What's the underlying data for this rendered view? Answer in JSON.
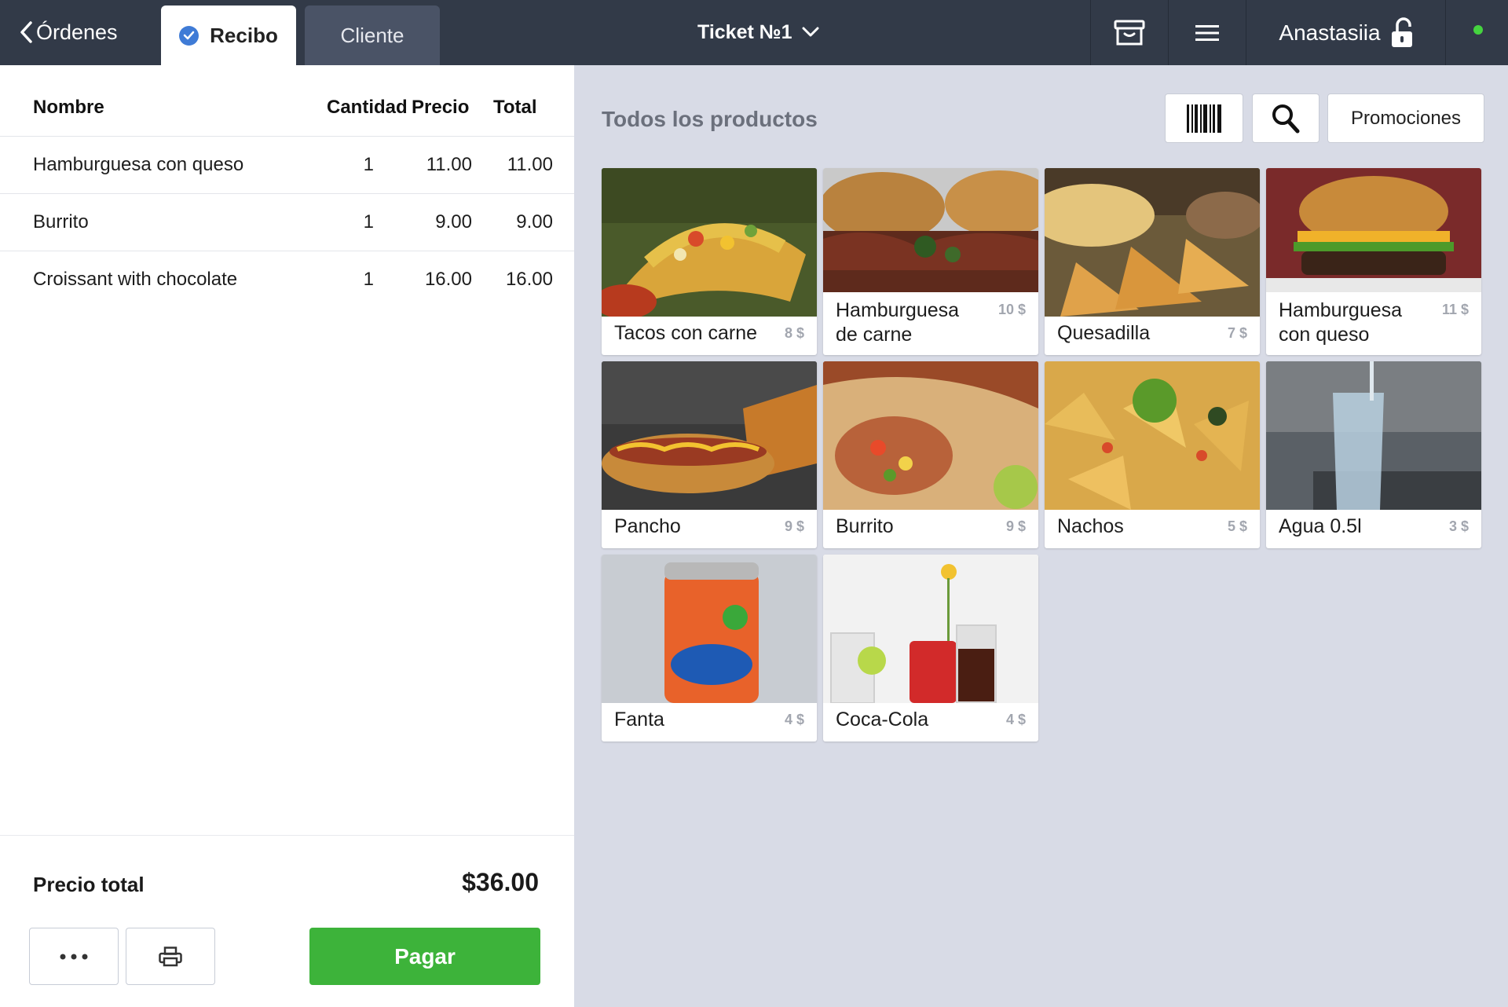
{
  "header": {
    "back_label": "Órdenes",
    "tabs": [
      {
        "label": "Recibo",
        "active": true
      },
      {
        "label": "Cliente",
        "active": false
      }
    ],
    "ticket_label": "Ticket №1",
    "user_name": "Anastasiia",
    "status_color": "#45d43f"
  },
  "receipt": {
    "columns": [
      "Nombre",
      "Cantidad",
      "Precio",
      "Total"
    ],
    "rows": [
      {
        "name": "Hamburguesa con queso",
        "qty": "1",
        "price": "11.00",
        "total": "11.00"
      },
      {
        "name": "Burrito",
        "qty": "1",
        "price": "9.00",
        "total": "9.00"
      },
      {
        "name": "Croissant with chocolate",
        "qty": "1",
        "price": "16.00",
        "total": "16.00"
      }
    ],
    "total_label": "Precio total",
    "total_value": "$36.00",
    "pay_label": "Pagar",
    "pay_color": "#3db33a"
  },
  "catalog": {
    "title": "Todos los productos",
    "promotions_label": "Promociones",
    "products": [
      {
        "name": "Tacos con carne",
        "price": "8 $",
        "image": "tacos"
      },
      {
        "name": "Hamburguesa de carne",
        "price": "10 $",
        "image": "beef-burger"
      },
      {
        "name": "Quesadilla",
        "price": "7 $",
        "image": "quesadilla"
      },
      {
        "name": "Hamburguesa con queso",
        "price": "11 $",
        "image": "cheeseburger"
      },
      {
        "name": "Pancho",
        "price": "9 $",
        "image": "hotdog"
      },
      {
        "name": "Burrito",
        "price": "9 $",
        "image": "burrito"
      },
      {
        "name": "Nachos",
        "price": "5 $",
        "image": "nachos"
      },
      {
        "name": "Agua 0.5l",
        "price": "3 $",
        "image": "water-glass"
      },
      {
        "name": "Fanta",
        "price": "4 $",
        "image": "fanta-can"
      },
      {
        "name": "Coca-Cola",
        "price": "4 $",
        "image": "coca-cola"
      }
    ]
  }
}
